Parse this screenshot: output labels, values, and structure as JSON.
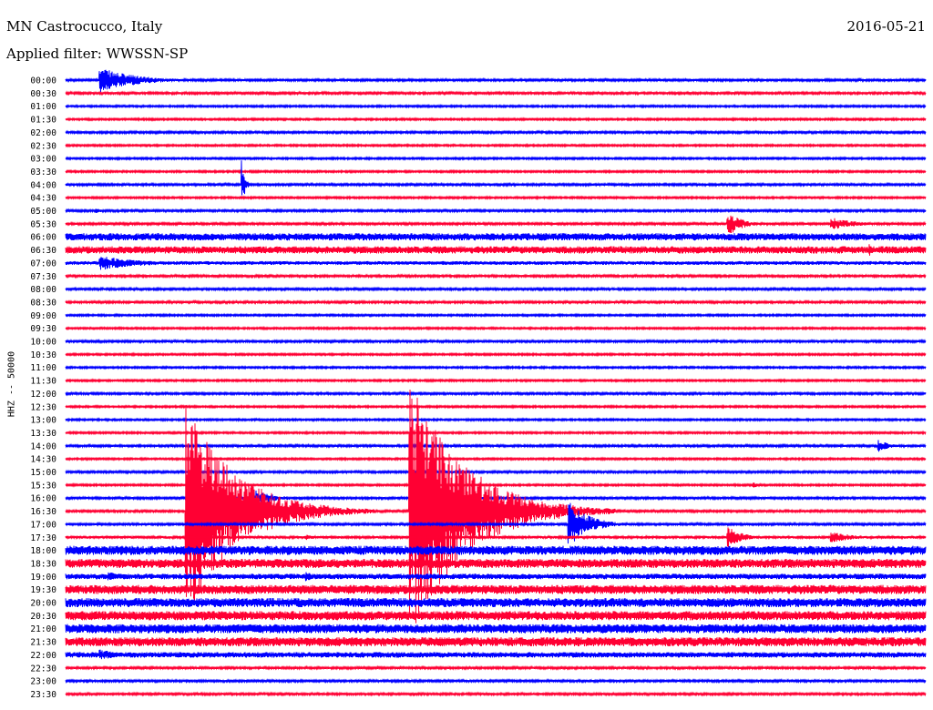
{
  "header": {
    "station": "MN Castrocucco, Italy",
    "date": "2016-05-21",
    "filter": "Applied filter: WWSSN-SP"
  },
  "chart_data": {
    "type": "line",
    "title": "MN Castrocucco, Italy",
    "ylabel": "HHZ -- 50000",
    "colors": {
      "even_row": "#0000ff",
      "odd_row": "#ff0033"
    },
    "rows": [
      {
        "label": "00:00",
        "noise": 1.2,
        "events": [
          {
            "x": 0.04,
            "amp": 14,
            "dur": 0.16
          }
        ]
      },
      {
        "label": "00:30",
        "noise": 1.2,
        "events": []
      },
      {
        "label": "01:00",
        "noise": 1.0,
        "events": []
      },
      {
        "label": "01:30",
        "noise": 1.0,
        "events": []
      },
      {
        "label": "02:00",
        "noise": 1.2,
        "events": []
      },
      {
        "label": "02:30",
        "noise": 1.0,
        "events": []
      },
      {
        "label": "03:00",
        "noise": 1.0,
        "events": []
      },
      {
        "label": "03:30",
        "noise": 1.0,
        "events": []
      },
      {
        "label": "04:00",
        "noise": 1.2,
        "events": [
          {
            "x": 0.205,
            "amp": 26,
            "dur": 0.012
          }
        ]
      },
      {
        "label": "04:30",
        "noise": 1.0,
        "events": []
      },
      {
        "label": "05:00",
        "noise": 1.2,
        "events": [
          {
            "x": 0.035,
            "amp": 4,
            "dur": 0.02
          }
        ]
      },
      {
        "label": "05:30",
        "noise": 1.2,
        "events": [
          {
            "x": 0.77,
            "amp": 14,
            "dur": 0.06
          },
          {
            "x": 0.89,
            "amp": 7,
            "dur": 0.11
          }
        ]
      },
      {
        "label": "06:00",
        "noise": 4.0,
        "events": []
      },
      {
        "label": "06:30",
        "noise": 4.0,
        "events": [
          {
            "x": 0.935,
            "amp": 9,
            "dur": 0.01
          }
        ]
      },
      {
        "label": "07:00",
        "noise": 2.0,
        "events": [
          {
            "x": 0.04,
            "amp": 8,
            "dur": 0.2
          }
        ]
      },
      {
        "label": "07:30",
        "noise": 1.2,
        "events": []
      },
      {
        "label": "08:00",
        "noise": 1.2,
        "events": []
      },
      {
        "label": "08:30",
        "noise": 1.2,
        "events": []
      },
      {
        "label": "09:00",
        "noise": 1.0,
        "events": []
      },
      {
        "label": "09:30",
        "noise": 1.0,
        "events": []
      },
      {
        "label": "10:00",
        "noise": 1.2,
        "events": []
      },
      {
        "label": "10:30",
        "noise": 1.0,
        "events": []
      },
      {
        "label": "11:00",
        "noise": 1.0,
        "events": []
      },
      {
        "label": "11:30",
        "noise": 1.0,
        "events": []
      },
      {
        "label": "12:00",
        "noise": 1.2,
        "events": []
      },
      {
        "label": "12:30",
        "noise": 1.0,
        "events": []
      },
      {
        "label": "13:00",
        "noise": 1.0,
        "events": []
      },
      {
        "label": "13:30",
        "noise": 1.0,
        "events": []
      },
      {
        "label": "14:00",
        "noise": 1.2,
        "events": [
          {
            "x": 0.945,
            "amp": 7,
            "dur": 0.05
          }
        ]
      },
      {
        "label": "14:30",
        "noise": 1.0,
        "events": []
      },
      {
        "label": "15:00",
        "noise": 1.2,
        "events": []
      },
      {
        "label": "15:30",
        "noise": 1.0,
        "events": [
          {
            "x": 0.8,
            "amp": 3,
            "dur": 0.03
          }
        ]
      },
      {
        "label": "16:00",
        "noise": 1.2,
        "events": [
          {
            "x": 0.22,
            "amp": 9,
            "dur": 0.1
          }
        ]
      },
      {
        "label": "16:30",
        "noise": 1.2,
        "events": [
          {
            "x": 0.14,
            "amp": 120,
            "dur": 0.22
          },
          {
            "x": 0.4,
            "amp": 150,
            "dur": 0.24
          }
        ]
      },
      {
        "label": "17:00",
        "noise": 1.2,
        "events": [
          {
            "x": 0.585,
            "amp": 26,
            "dur": 0.09
          }
        ]
      },
      {
        "label": "17:30",
        "noise": 1.5,
        "events": [
          {
            "x": 0.28,
            "amp": 3,
            "dur": 0.05
          },
          {
            "x": 0.77,
            "amp": 13,
            "dur": 0.06
          },
          {
            "x": 0.89,
            "amp": 6,
            "dur": 0.11
          }
        ]
      },
      {
        "label": "18:00",
        "noise": 5.0,
        "events": []
      },
      {
        "label": "18:30",
        "noise": 5.0,
        "events": []
      },
      {
        "label": "19:00",
        "noise": 3.0,
        "events": [
          {
            "x": 0.05,
            "amp": 5,
            "dur": 0.1
          },
          {
            "x": 0.28,
            "amp": 5,
            "dur": 0.06
          }
        ]
      },
      {
        "label": "19:30",
        "noise": 5.0,
        "events": []
      },
      {
        "label": "20:00",
        "noise": 5.0,
        "events": []
      },
      {
        "label": "20:30",
        "noise": 5.0,
        "events": []
      },
      {
        "label": "21:00",
        "noise": 5.0,
        "events": []
      },
      {
        "label": "21:30",
        "noise": 5.0,
        "events": []
      },
      {
        "label": "22:00",
        "noise": 3.0,
        "events": [
          {
            "x": 0.04,
            "amp": 6,
            "dur": 0.1
          }
        ]
      },
      {
        "label": "22:30",
        "noise": 1.2,
        "events": []
      },
      {
        "label": "23:00",
        "noise": 1.2,
        "events": [
          {
            "x": 0.025,
            "amp": 3,
            "dur": 0.005
          }
        ]
      },
      {
        "label": "23:30",
        "noise": 1.2,
        "events": []
      }
    ]
  }
}
